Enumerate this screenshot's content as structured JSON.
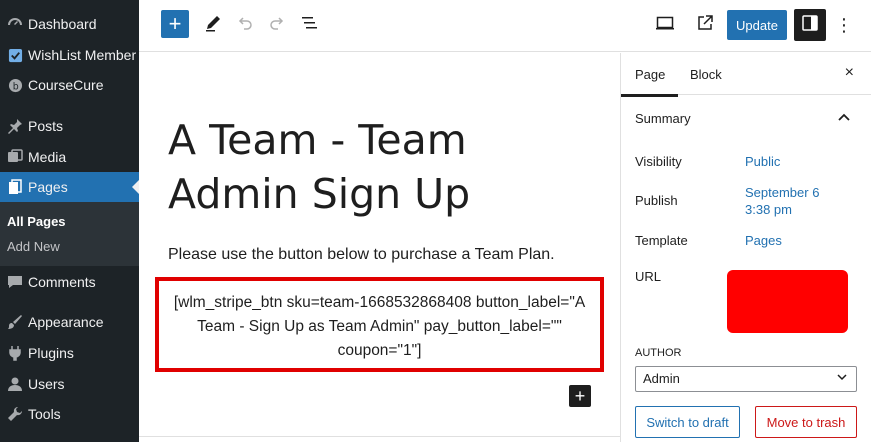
{
  "admin_menu": {
    "items": [
      {
        "label": "Dashboard",
        "icon": "dashboard-icon"
      },
      {
        "label": "WishList Member",
        "icon": "wishlist-icon"
      },
      {
        "label": "CourseCure",
        "icon": "coursecure-icon"
      },
      {
        "label": "Posts",
        "icon": "pin-icon"
      },
      {
        "label": "Media",
        "icon": "media-icon"
      },
      {
        "label": "Pages",
        "icon": "pages-icon",
        "active": true
      },
      {
        "label": "Comments",
        "icon": "comments-icon"
      },
      {
        "label": "Appearance",
        "icon": "appearance-icon"
      },
      {
        "label": "Plugins",
        "icon": "plugins-icon"
      },
      {
        "label": "Users",
        "icon": "users-icon"
      },
      {
        "label": "Tools",
        "icon": "tools-icon"
      }
    ],
    "submenu": [
      {
        "label": "All Pages",
        "current": true
      },
      {
        "label": "Add New"
      }
    ]
  },
  "toolbar": {
    "add_block": "+",
    "update_label": "Update",
    "more": "⋮"
  },
  "editor": {
    "title": "A Team - Team Admin Sign Up",
    "paragraph": "Please use the button below to purchase a Team Plan.",
    "shortcode": "[wlm_stripe_btn sku=team-1668532868408 button_label=\"A Team - Sign Up as Team Admin\" pay_button_label=\"\" coupon=\"1\"]",
    "inline_add": "+"
  },
  "settings": {
    "tabs": [
      "Page",
      "Block"
    ],
    "close": "×",
    "panel_title": "Summary",
    "rows": {
      "visibility_label": "Visibility",
      "visibility_value": "Public",
      "publish_label": "Publish",
      "publish_value_line1": "September 6",
      "publish_value_line2": "3:38 pm",
      "template_label": "Template",
      "template_value": "Pages",
      "url_label": "URL"
    },
    "author_label": "AUTHOR",
    "author_value": "Admin",
    "switch_to_draft": "Switch to draft",
    "move_to_trash": "Move to trash"
  },
  "colors": {
    "admin_bg": "#1d2327",
    "accent": "#2271b1",
    "highlight_border": "#e00000",
    "trash": "#cc1818"
  }
}
